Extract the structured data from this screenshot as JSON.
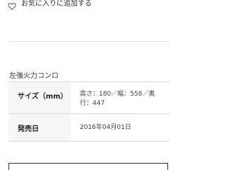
{
  "favorite": {
    "icon": "heart-outline-icon",
    "label": "お気に入りに追加する"
  },
  "specs": {
    "section_title": "左強火力コンロ",
    "rows": [
      {
        "key": "サイズ（mm）",
        "value": "高さ：180／幅：558／奥行：447"
      },
      {
        "key": "発売日",
        "value": "2016年04月01日"
      }
    ]
  }
}
